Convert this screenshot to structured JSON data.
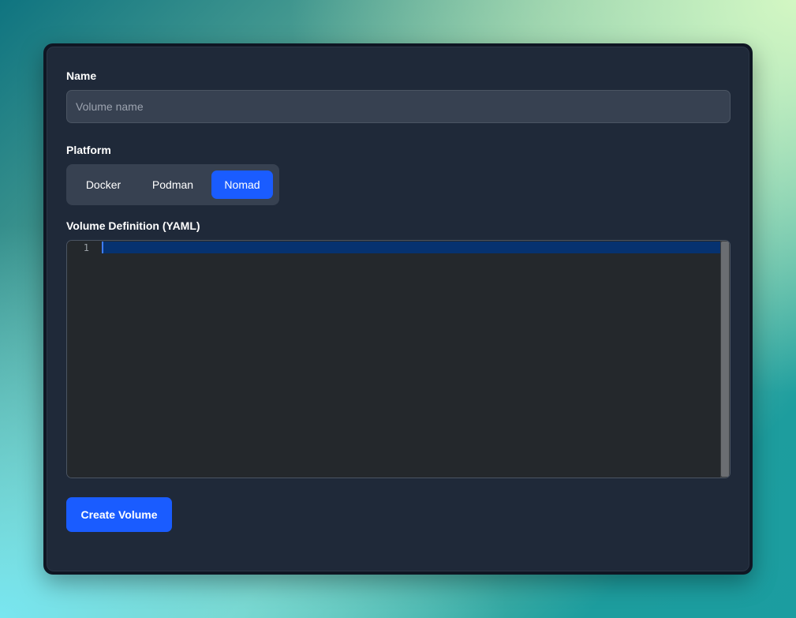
{
  "form": {
    "name_label": "Name",
    "name_value": "",
    "name_placeholder": "Volume name",
    "platform_label": "Platform",
    "platforms": [
      {
        "label": "Docker",
        "selected": false
      },
      {
        "label": "Podman",
        "selected": false
      },
      {
        "label": "Nomad",
        "selected": true
      }
    ],
    "yaml_label": "Volume Definition (YAML)",
    "editor": {
      "line_numbers": [
        "1"
      ],
      "content": ""
    },
    "submit_label": "Create Volume"
  },
  "colors": {
    "accent": "#1a5cff",
    "panel": "#1f2939",
    "input_bg": "#374151",
    "editor_bg": "#24282c",
    "active_line": "#063270"
  }
}
